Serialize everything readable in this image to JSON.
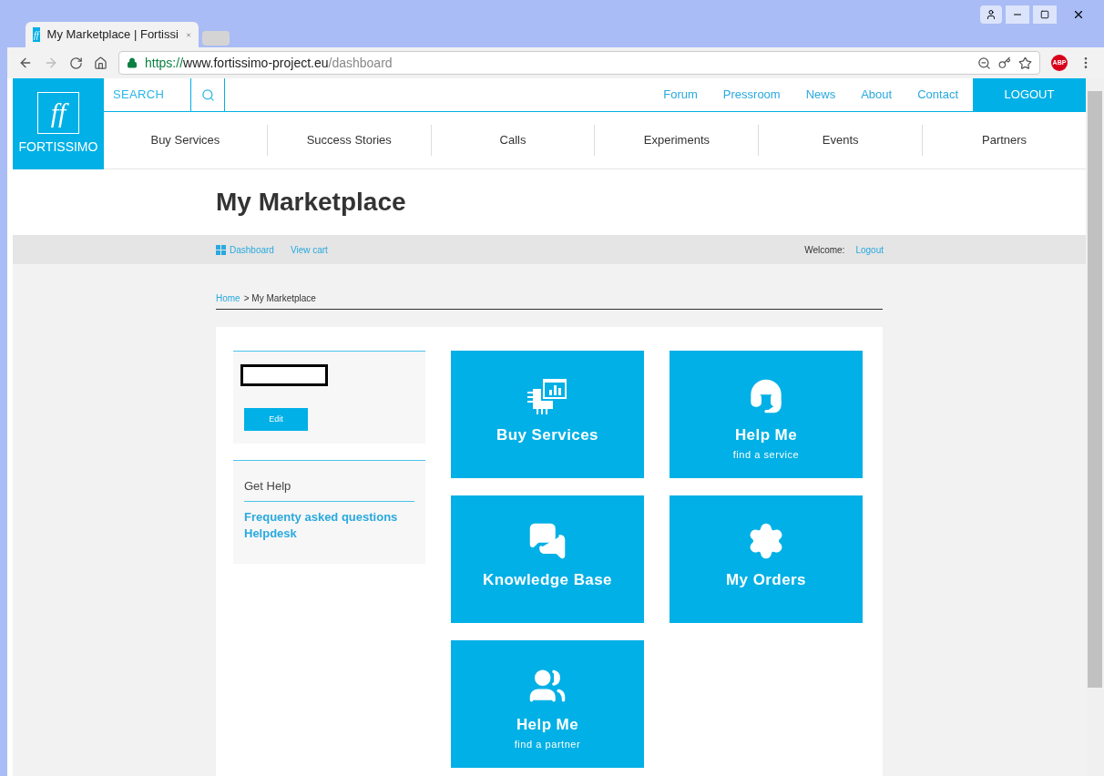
{
  "browser": {
    "tab_title": "My Marketplace | Fortissi",
    "url_scheme": "https://",
    "url_host": "www.fortissimo-project.eu",
    "url_path": "/dashboard",
    "extension_badge": "ABP",
    "favicon_mark": "ff"
  },
  "header": {
    "logo_mark": "ff",
    "logo_text": "FORTISSIMO",
    "search_placeholder": "SEARCH",
    "top_links": [
      "Forum",
      "Pressroom",
      "News",
      "About",
      "Contact"
    ],
    "logout": "LOGOUT",
    "nav": [
      "Buy Services",
      "Success Stories",
      "Calls",
      "Experiments",
      "Events",
      "Partners"
    ]
  },
  "page_title": "My Marketplace",
  "subnav": {
    "links": [
      "Dashboard",
      "View cart"
    ],
    "welcome": "Welcome:",
    "logout": "Logout"
  },
  "breadcrumb": {
    "home": "Home",
    "separator": ">",
    "current": "My Marketplace"
  },
  "profile": {
    "edit": "Edit"
  },
  "help": {
    "title": "Get Help",
    "links": [
      "Frequenty asked questions",
      "Helpdesk"
    ]
  },
  "tiles": [
    {
      "title": "Buy Services"
    },
    {
      "title": "Help Me",
      "subtitle": "find a service"
    },
    {
      "title": "Knowledge Base"
    },
    {
      "title": "My Orders"
    },
    {
      "title": "Help Me",
      "subtitle": "find a partner"
    }
  ]
}
